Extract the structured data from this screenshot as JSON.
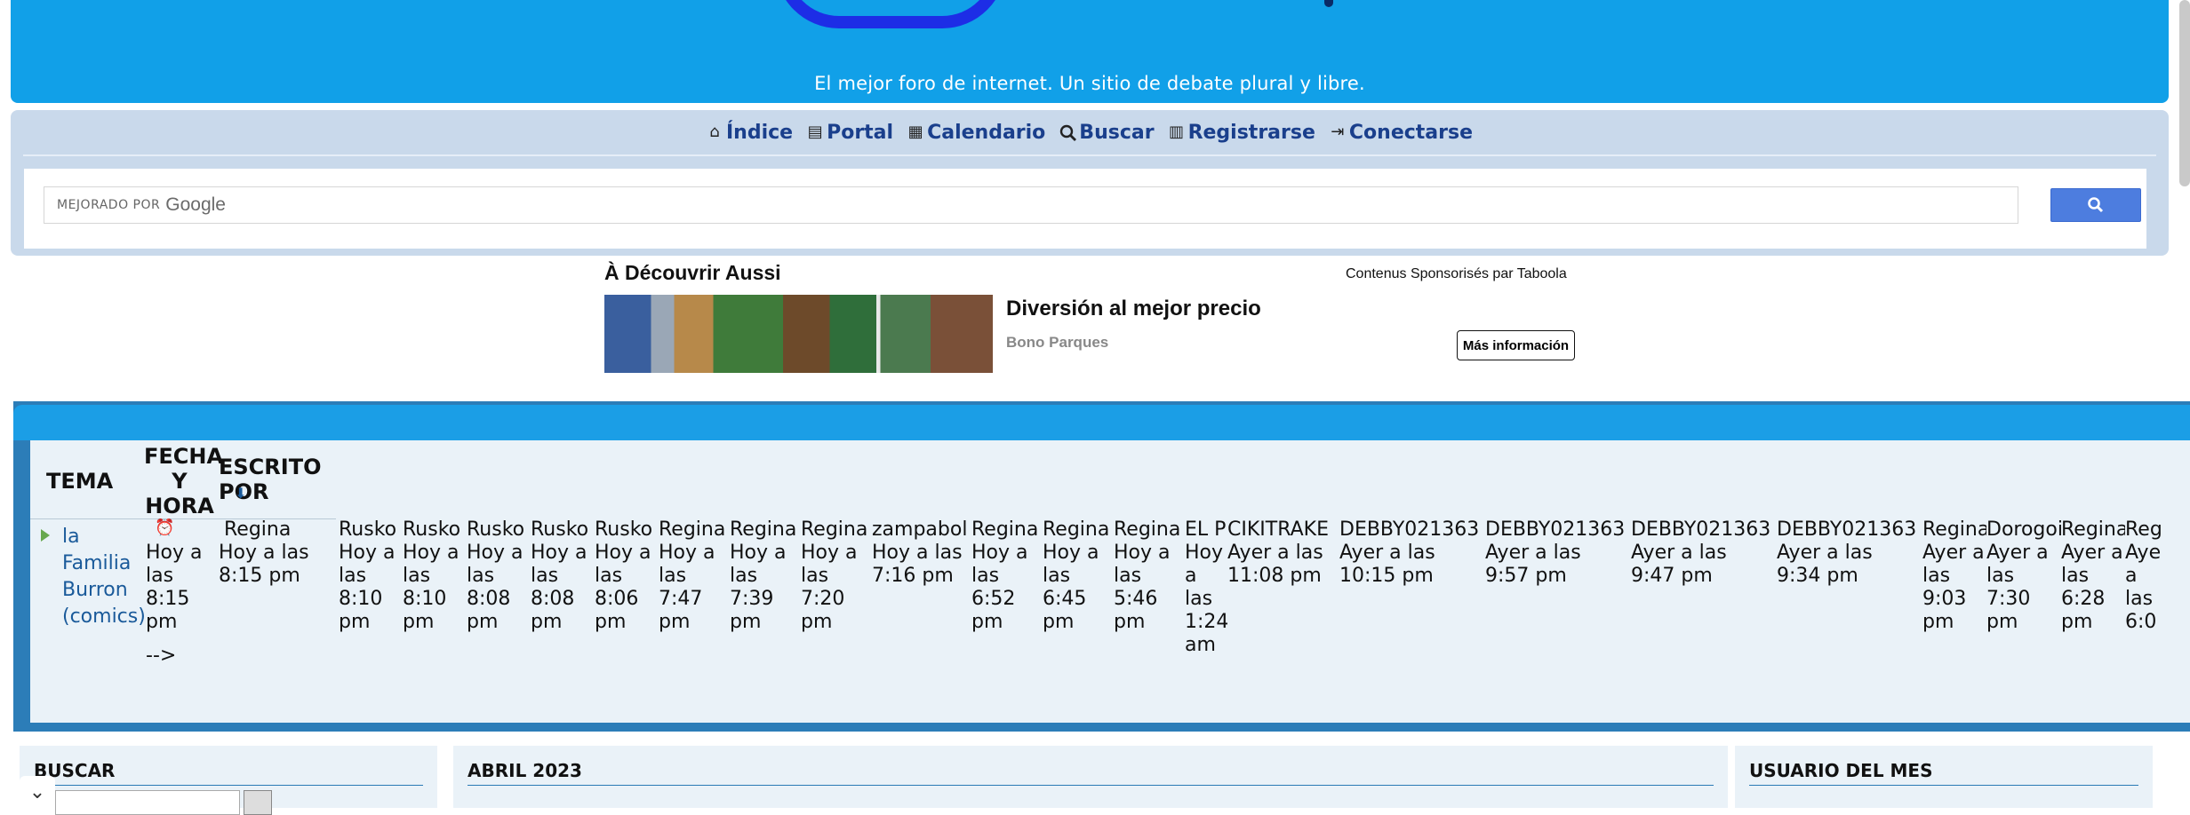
{
  "header": {
    "tagline": "El mejor foro de internet. Un sitio de debate plural y libre."
  },
  "nav": {
    "items": [
      {
        "label": "Índice",
        "icon": "home-icon"
      },
      {
        "label": "Portal",
        "icon": "portal-icon"
      },
      {
        "label": "Calendario",
        "icon": "calendar-icon"
      },
      {
        "label": "Buscar",
        "icon": "search-icon"
      },
      {
        "label": "Registrarse",
        "icon": "register-icon"
      },
      {
        "label": "Conectarse",
        "icon": "login-icon"
      }
    ]
  },
  "google_search": {
    "powered_by": "MEJORADO POR",
    "brand": "Google"
  },
  "taboola": {
    "title": "À Découvrir Aussi",
    "sponsor": "Contenus Sponsorisés par Taboola",
    "headline": "Diversión al mejor precio",
    "brand": "Bono Parques",
    "cta": "Más información"
  },
  "topics": {
    "headers": {
      "tema": "TEMA",
      "fecha": "FECHA Y HORA",
      "escrito": "ESCRITO POR"
    },
    "topic": "la Familia Burron (comics)",
    "first_date": "Hoy a las 8:15 pm",
    "first_extra": "-->",
    "first_author": "Regina",
    "first_author_date": "Hoy a las 8:15 pm",
    "posts": [
      {
        "author": "Rusko",
        "date": "Hoy a las 8:10 pm"
      },
      {
        "author": "Rusko",
        "date": "Hoy a las 8:10 pm"
      },
      {
        "author": "Rusko",
        "date": "Hoy a las 8:08 pm"
      },
      {
        "author": "Rusko",
        "date": "Hoy a las 8:08 pm"
      },
      {
        "author": "Rusko",
        "date": "Hoy a las 8:06 pm"
      },
      {
        "author": "Regina",
        "date": "Hoy a las 7:47 pm"
      },
      {
        "author": "Regina",
        "date": "Hoy a las 7:39 pm"
      },
      {
        "author": "Regina",
        "date": "Hoy a las 7:20 pm"
      },
      {
        "author": "zampabol",
        "date": "Hoy a las 7:16 pm"
      },
      {
        "author": "Regina",
        "date": "Hoy a las 6:52 pm"
      },
      {
        "author": "Regina",
        "date": "Hoy a las 6:45 pm"
      },
      {
        "author": "Regina",
        "date": "Hoy a las 5:46 pm"
      },
      {
        "author": "EL PIRO",
        "date": "Hoy a las 1:24 am"
      },
      {
        "author": "CIKITRAKE",
        "date": "Ayer a las 11:08 pm"
      },
      {
        "author": "DEBBY021363",
        "date": "Ayer a las 10:15 pm"
      },
      {
        "author": "DEBBY021363",
        "date": "Ayer a las 9:57 pm"
      },
      {
        "author": "DEBBY021363",
        "date": "Ayer a las 9:47 pm"
      },
      {
        "author": "DEBBY021363",
        "date": "Ayer a las 9:34 pm"
      },
      {
        "author": "Regina",
        "date": "Ayer a las 9:03 pm"
      },
      {
        "author": "Dorogoi",
        "date": "Ayer a las 7:30 pm"
      },
      {
        "author": "Regina",
        "date": "Ayer a las 6:28 pm"
      },
      {
        "author": "Reg",
        "date": "Aye a las 6:0"
      }
    ]
  },
  "panels": {
    "buscar": "BUSCAR",
    "abril": "ABRIL 2023",
    "usuario": "USUARIO DEL MES"
  }
}
